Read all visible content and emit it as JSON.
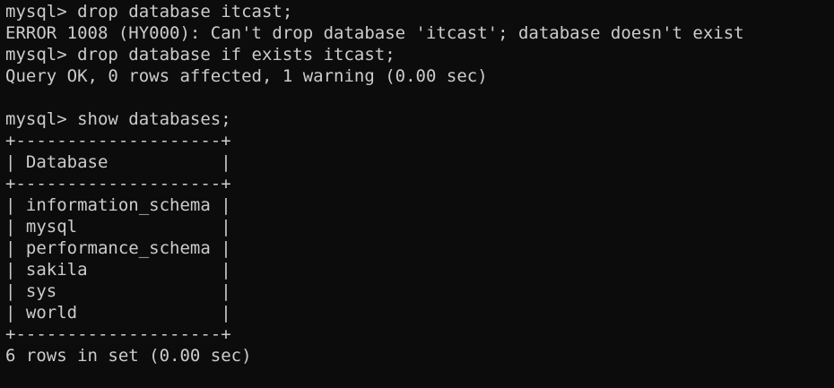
{
  "terminal": {
    "background": "#0c0c0c",
    "foreground": "#cccccc",
    "lines": [
      "mysql> drop database itcast;",
      "ERROR 1008 (HY000): Can't drop database 'itcast'; database doesn't exist",
      "mysql> drop database if exists itcast;",
      "Query OK, 0 rows affected, 1 warning (0.00 sec)",
      "",
      "mysql> show databases;",
      "+--------------------+",
      "| Database           |",
      "+--------------------+",
      "| information_schema |",
      "| mysql              |",
      "| performance_schema |",
      "| sakila             |",
      "| sys                |",
      "| world              |",
      "+--------------------+",
      "6 rows in set (0.00 sec)"
    ]
  }
}
